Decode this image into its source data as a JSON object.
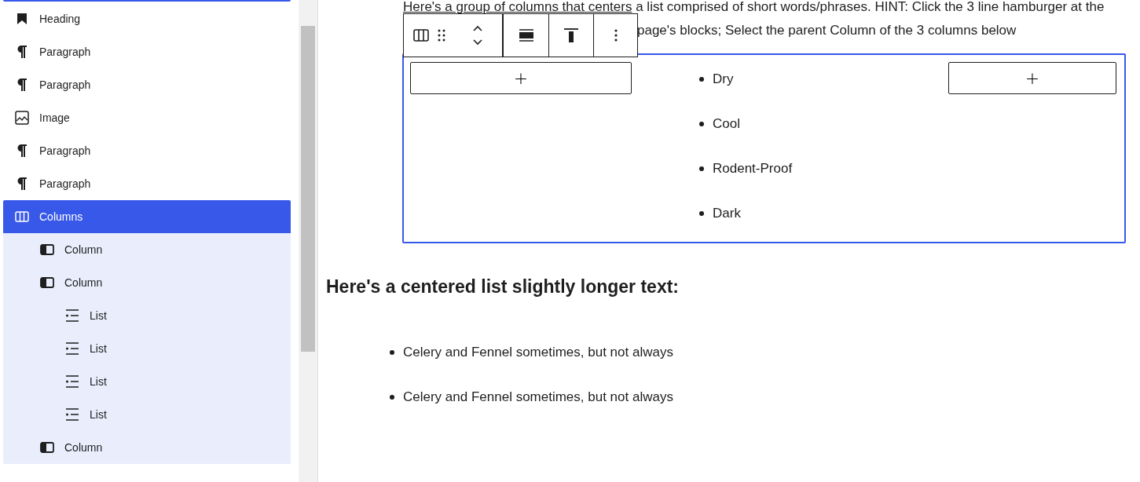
{
  "list_view": {
    "items": [
      {
        "kind": "heading",
        "label": "Heading",
        "selected": false
      },
      {
        "kind": "paragraph",
        "label": "Paragraph",
        "selected": false
      },
      {
        "kind": "paragraph",
        "label": "Paragraph",
        "selected": false
      },
      {
        "kind": "image",
        "label": "Image",
        "selected": false
      },
      {
        "kind": "paragraph",
        "label": "Paragraph",
        "selected": false
      },
      {
        "kind": "paragraph",
        "label": "Paragraph",
        "selected": false
      },
      {
        "kind": "columns",
        "label": "Columns",
        "selected": true,
        "children": [
          {
            "kind": "column",
            "label": "Column",
            "selected": false
          },
          {
            "kind": "column",
            "label": "Column",
            "selected": false,
            "children": [
              {
                "kind": "list",
                "label": "List",
                "selected": false
              },
              {
                "kind": "list",
                "label": "List",
                "selected": false
              },
              {
                "kind": "list",
                "label": "List",
                "selected": false
              },
              {
                "kind": "list",
                "label": "List",
                "selected": false
              }
            ]
          },
          {
            "kind": "column",
            "label": "Column",
            "selected": false
          }
        ]
      }
    ]
  },
  "block_toolbar": {
    "buttons": [
      {
        "kind": "columns"
      },
      {
        "kind": "drag"
      },
      {
        "kind": "move"
      },
      {
        "kind": "align-full"
      },
      {
        "kind": "valign-top"
      },
      {
        "kind": "more"
      }
    ]
  },
  "intro_paragraph": {
    "link": "Here's a group of columns that centers",
    "text": " a list comprised of short words/phrases. HINT: Click the 3 line hamburger at the",
    "continuation": "page's blocks; Select the parent Column of the 3 columns below"
  },
  "columns_block": {
    "selected": true,
    "columns": [
      {
        "kind": "appender",
        "label": "+"
      },
      {
        "kind": "list",
        "items": [
          "Dry",
          "Cool",
          "Rodent-Proof",
          "Dark"
        ]
      },
      {
        "kind": "appender",
        "label": "+"
      }
    ]
  },
  "heading": "Here's a centered list slightly longer text:",
  "centered_list": [
    "Celery and Fennel sometimes, but not always",
    "Celery and Fennel sometimes, but not always"
  ]
}
